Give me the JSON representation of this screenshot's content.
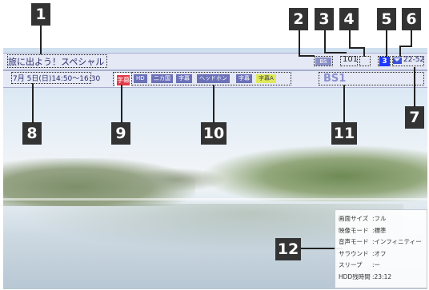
{
  "program": {
    "title": "旅に出よう！スペシャル",
    "date_time": "7月 5日(日)14:50～16:30",
    "banner_bs": "BS",
    "channel": "101",
    "tag_three": "3",
    "time_range": "22-52",
    "subtitle_tag": "字幕",
    "station": "BS1"
  },
  "status_tags": [
    "HD",
    "二カ国",
    "字幕",
    "ヘッドホン",
    "字幕",
    "字幕A"
  ],
  "callouts": [
    "1",
    "2",
    "3",
    "4",
    "5",
    "6",
    "7",
    "8",
    "9",
    "10",
    "11",
    "12"
  ],
  "info_panel": {
    "rows": [
      {
        "label": "画面サイズ",
        "value": "フル"
      },
      {
        "label": "映像モード",
        "value": "標準"
      },
      {
        "label": "音声モード",
        "value": "インフィニティー"
      },
      {
        "label": "サラウンド",
        "value": "オフ"
      },
      {
        "label": "スリープ",
        "value": "ー"
      },
      {
        "label": "HDD残時間",
        "value": "23:12"
      }
    ]
  },
  "colors": {
    "accent_blue": "#1e39ff",
    "bar_blue": "#6c71b8",
    "highlight_red": "#e33a4a",
    "callout_dark": "#333333"
  }
}
